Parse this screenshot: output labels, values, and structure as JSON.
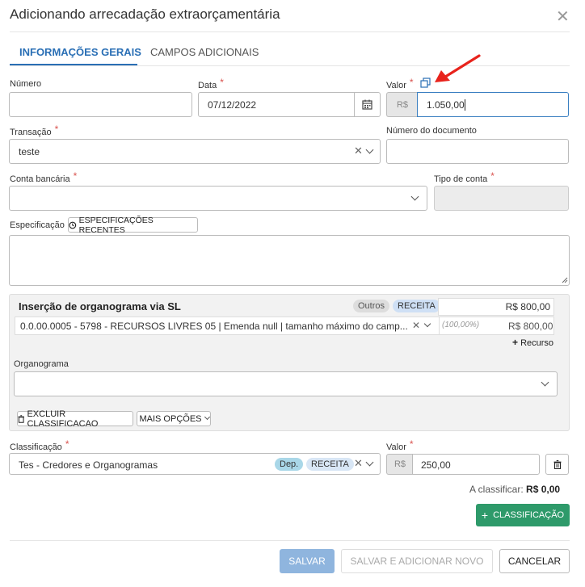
{
  "dialog": {
    "title": "Adicionando arrecadação extraorçamentária"
  },
  "tabs": [
    {
      "label": "INFORMAÇÕES GERAIS",
      "active": true
    },
    {
      "label": "CAMPOS ADICIONAIS",
      "active": false
    }
  ],
  "fields": {
    "numero": {
      "label": "Número",
      "value": ""
    },
    "data": {
      "label": "Data",
      "value": "07/12/2022"
    },
    "valor": {
      "label": "Valor",
      "prefix": "R$",
      "value": "1.050,00"
    },
    "transacao": {
      "label": "Transação",
      "value": "teste"
    },
    "numero_documento": {
      "label": "Número do documento",
      "value": ""
    },
    "conta_bancaria": {
      "label": "Conta bancária",
      "value": ""
    },
    "tipo_conta": {
      "label": "Tipo de conta",
      "value": ""
    },
    "especificacao": {
      "label": "Especificação",
      "recent_button": "ESPECIFICAÇÕES RECENTES",
      "value": ""
    }
  },
  "organograma_panel": {
    "title": "Inserção de organograma via SL",
    "badge_outros": "Outros",
    "badge_receita": "RECEITA",
    "total": "R$ 800,00",
    "row": {
      "text": "0.0.00.0005 - 5798 - RECURSOS LIVRES 05 | Emenda null | tamanho máximo do camp...",
      "percent": "(100,00%)",
      "amount": "R$ 800,00"
    },
    "add_recurso": "Recurso",
    "organograma_label": "Organograma",
    "organograma_value": "",
    "excluir_button": "EXCLUIR CLASSIFICACAO",
    "mais_opcoes_button": "MAIS OPÇÕES"
  },
  "classificacao": {
    "label": "Classificação",
    "value": "Tes - Credores e Organogramas",
    "badge_dep": "Dep.",
    "badge_receita": "RECEITA",
    "valor_label": "Valor",
    "valor_prefix": "R$",
    "valor_value": "250,00",
    "a_classificar_label": "A classificar:",
    "a_classificar_value": "R$ 0,00",
    "add_button": "CLASSIFICAÇÃO"
  },
  "footer": {
    "salvar": "SALVAR",
    "salvar_novo": "SALVAR E ADICIONAR NOVO",
    "cancelar": "CANCELAR"
  },
  "colors": {
    "accent": "#2a6fb5",
    "required": "#d9534f",
    "annotation_arrow": "#e8231c",
    "green": "#2e9a6a"
  }
}
